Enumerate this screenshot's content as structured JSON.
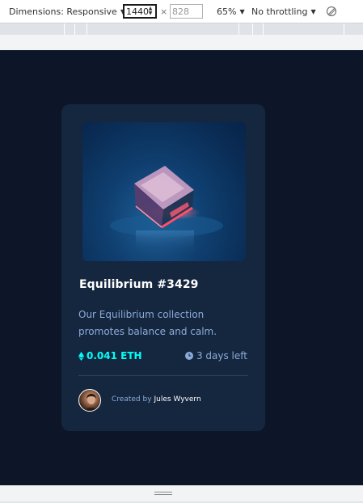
{
  "toolbar": {
    "dimensions_label": "Dimensions: Responsive",
    "width_value": "1440",
    "times_symbol": "×",
    "height_placeholder": "828",
    "zoom_label": "65%",
    "throttling_label": "No throttling",
    "rotate_icon": "rotate-icon"
  },
  "card": {
    "title": "Equilibrium #3429",
    "description": "Our Equilibrium collection promotes balance and calm.",
    "price": "0.041 ETH",
    "time_left": "3 days left",
    "creator_prefix": "Created by",
    "creator_name": "Jules Wyvern"
  },
  "colors": {
    "page_bg": "#0d1628",
    "card_bg": "#15263f",
    "accent_cyan": "#00fff8",
    "soft_blue": "#8bacd9",
    "white": "#ffffff"
  },
  "icons": {
    "price_icon": "ethereum-icon",
    "time_icon": "clock-icon",
    "drawer_icon": "drag-handle-icon"
  }
}
